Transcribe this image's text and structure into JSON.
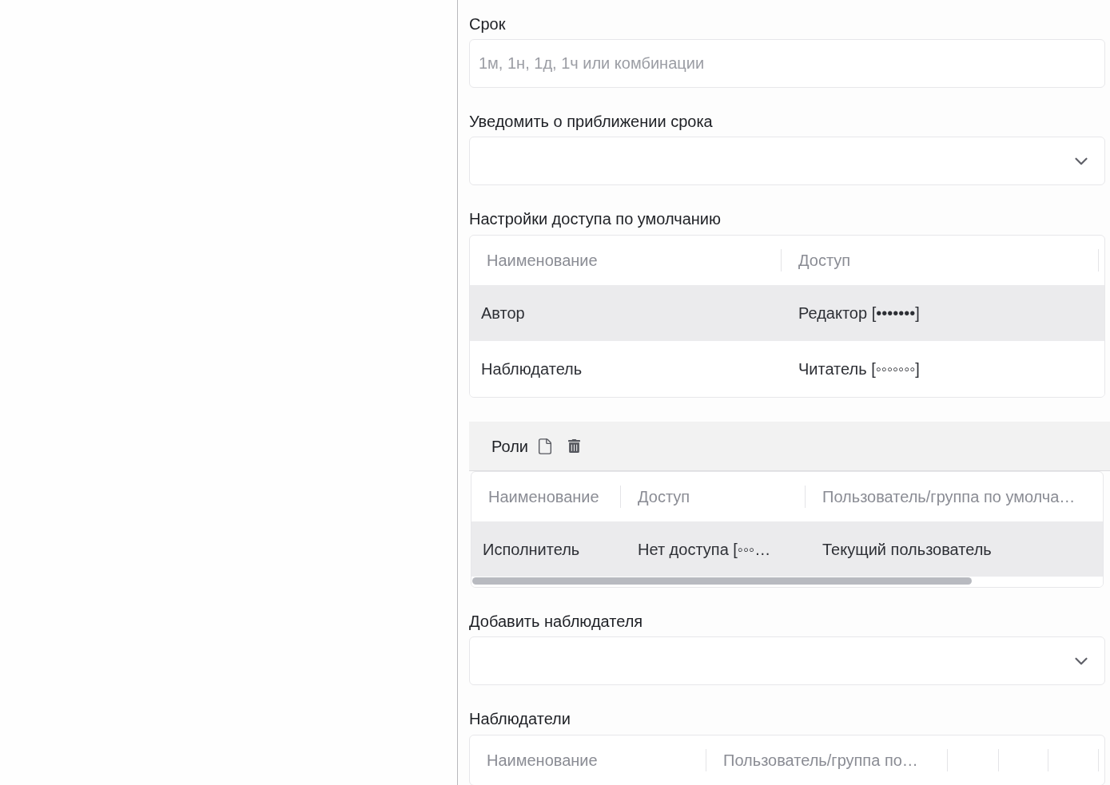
{
  "form": [
    {
      "kind": "input",
      "label": "Срок",
      "placeholder": "1м, 1н, 1д, 1ч или комбинации"
    },
    {
      "kind": "select",
      "label": "Уведомить о приближении срока"
    },
    {
      "kind": "table",
      "label": "Настройки доступа по умолчанию",
      "columns": [
        {
          "kind": "text",
          "label": "Наименование"
        },
        {
          "kind": "text",
          "label": "Доступ"
        }
      ],
      "rows": [
        {
          "cells": [
            "Автор",
            "Редактор [•••••••]"
          ],
          "selected": true
        },
        {
          "cells": [
            "Наблюдатель",
            "Читатель [◦◦◦◦◦◦◦]"
          ],
          "selected": false
        }
      ]
    },
    {
      "kind": "panel",
      "title": "Роли",
      "columns": [
        {
          "kind": "text",
          "label": "Наименование"
        },
        {
          "kind": "text",
          "label": "Доступ"
        },
        {
          "kind": "text",
          "label": "Пользователь/группа по умолча…"
        }
      ],
      "rows": [
        {
          "cells": [
            "Исполнитель",
            "Нет доступа [◦◦◦…",
            "Текущий пользователь"
          ],
          "selected": true
        }
      ]
    },
    {
      "kind": "select",
      "label": "Добавить наблюдателя"
    },
    {
      "kind": "table",
      "label": "Наблюдатели",
      "columns": [
        {
          "kind": "text",
          "label": "Наименование"
        },
        {
          "kind": "text",
          "label": "Пользователь/группа по…"
        },
        {
          "kind": "blank"
        },
        {
          "kind": "blank"
        },
        {
          "kind": "blank"
        }
      ]
    }
  ]
}
